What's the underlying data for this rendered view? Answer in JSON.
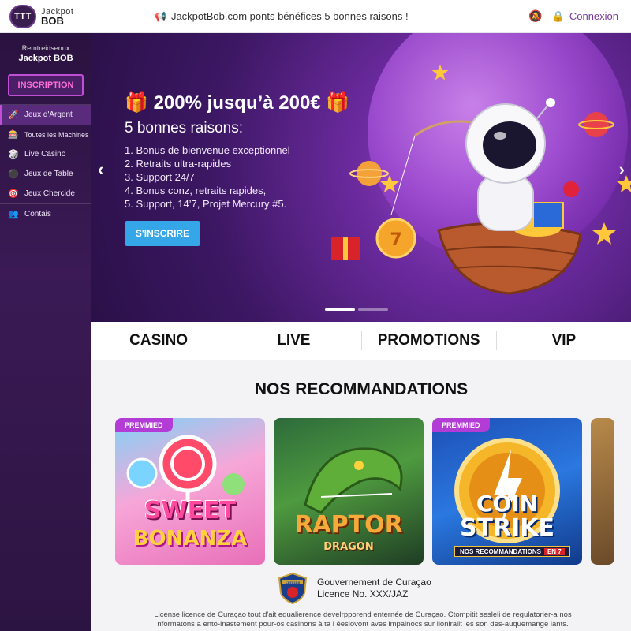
{
  "header": {
    "logo_badge": "TTT",
    "logo_line1": "Jackpot",
    "logo_line2": "BOB",
    "announcement": "JackpotBob.com ponts bénéfices 5 bonnes raisons !",
    "login_label": "Connexion"
  },
  "sidebar": {
    "subtitle": "Remtreidsenux",
    "name": "Jackpot BOB",
    "register_label": "INSCRIPTION",
    "items": [
      {
        "label": "Jeux d'Argent",
        "icon": "rocket-icon"
      },
      {
        "label": "Toutes les Machines",
        "icon": "slot-machine-icon"
      },
      {
        "label": "Live Casino",
        "icon": "live-icon"
      },
      {
        "label": "Jeux de Table",
        "icon": "chip-icon"
      },
      {
        "label": "Jeux Chercide",
        "icon": "dart-icon"
      },
      {
        "label": "Contais",
        "icon": "support-icon"
      }
    ]
  },
  "hero": {
    "title": "200% jusqu’à 200€",
    "subtitle": "5 bonnes raisons:",
    "reasons": [
      "1. Bonus de bienvenue exceptionnel",
      "2. Retraits ultra-rapides",
      "3. Support 24/7",
      "4. Bonus conz, retraits rapides,",
      "5. Support, 14’7, Projet Mercury #5."
    ],
    "cta_label": "S'INSCRIRE",
    "prev_arrow": "‹",
    "next_arrow": "›",
    "coin_number": "7"
  },
  "categories": [
    "CASINO",
    "LIVE",
    "PROMOTIONS",
    "VIP"
  ],
  "recommendations": {
    "title": "NOS RECOMMANDATIONS",
    "cards": [
      {
        "tag": "PREMMIED",
        "name_line1": "SWEET",
        "name_line2": "BONANZA"
      },
      {
        "tag": "",
        "name_line1": "RAPTOR",
        "name_line2": "DRAGON"
      },
      {
        "tag": "PREMMIED",
        "name_line1": "COIN",
        "name_line2": "STRIKE",
        "ribbon": "NOS RECOMMANDATIONS",
        "ribbon_badge": "EN 7"
      }
    ]
  },
  "footer": {
    "badge_label": "Curaçao",
    "license_line1": "Gouvernement de Curaçao",
    "license_line2": "Licence No. XXX/JAZ",
    "fine_print_line1": "License licence de Curaçao tout d'ait equalierence develrpporend enternée de Curaçao. Ctompitit sesleli de regulatorier-a nos",
    "fine_print_line2": "nformatons a ento-inastement pour-os casinons à ta i éesiovont aves impainocs sur lionirailt les son des-auquemange lants."
  },
  "colors": {
    "accent": "#c04fd6",
    "cta": "#35a7e8",
    "sidebar_bg": "#2a1240"
  }
}
